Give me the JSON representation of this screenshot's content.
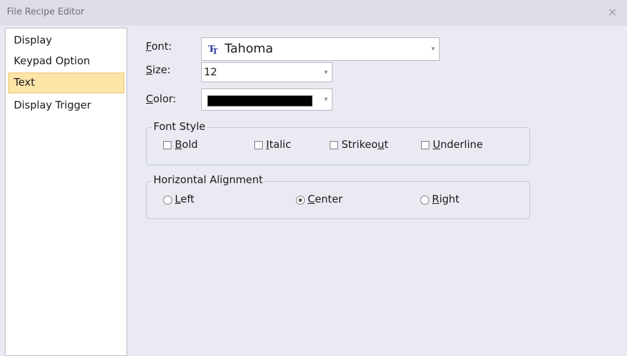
{
  "window": {
    "title": "File Recipe Editor",
    "close": "×"
  },
  "sidebar": {
    "items": [
      {
        "label": "Display",
        "selected": false
      },
      {
        "label": "Keypad Option",
        "selected": false
      },
      {
        "label": "Text",
        "selected": true
      },
      {
        "label": "Display Trigger",
        "selected": false
      }
    ]
  },
  "form": {
    "font": {
      "label_mn": "F",
      "label_rest": "ont:",
      "value": "Tahoma",
      "icon": "truetype-font-icon"
    },
    "size": {
      "label_mn": "S",
      "label_rest": "ize:",
      "value": "12"
    },
    "color": {
      "label_mn": "C",
      "label_rest": "olor:",
      "value": "#000000"
    },
    "dropdown_glyph": "▾"
  },
  "font_style": {
    "legend": "Font Style",
    "options": [
      {
        "pre": "",
        "mn": "B",
        "post": "old",
        "checked": false
      },
      {
        "pre": "",
        "mn": "I",
        "post": "talic",
        "checked": false
      },
      {
        "pre": "Strikeo",
        "mn": "u",
        "post": "t",
        "checked": false
      },
      {
        "pre": "",
        "mn": "U",
        "post": "nderline",
        "checked": false
      }
    ]
  },
  "alignment": {
    "legend": "Horizontal Alignment",
    "options": [
      {
        "pre": "",
        "mn": "L",
        "post": "eft",
        "selected": false
      },
      {
        "pre": "",
        "mn": "C",
        "post": "enter",
        "selected": true
      },
      {
        "pre": "",
        "mn": "R",
        "post": "ight",
        "selected": false
      }
    ]
  }
}
